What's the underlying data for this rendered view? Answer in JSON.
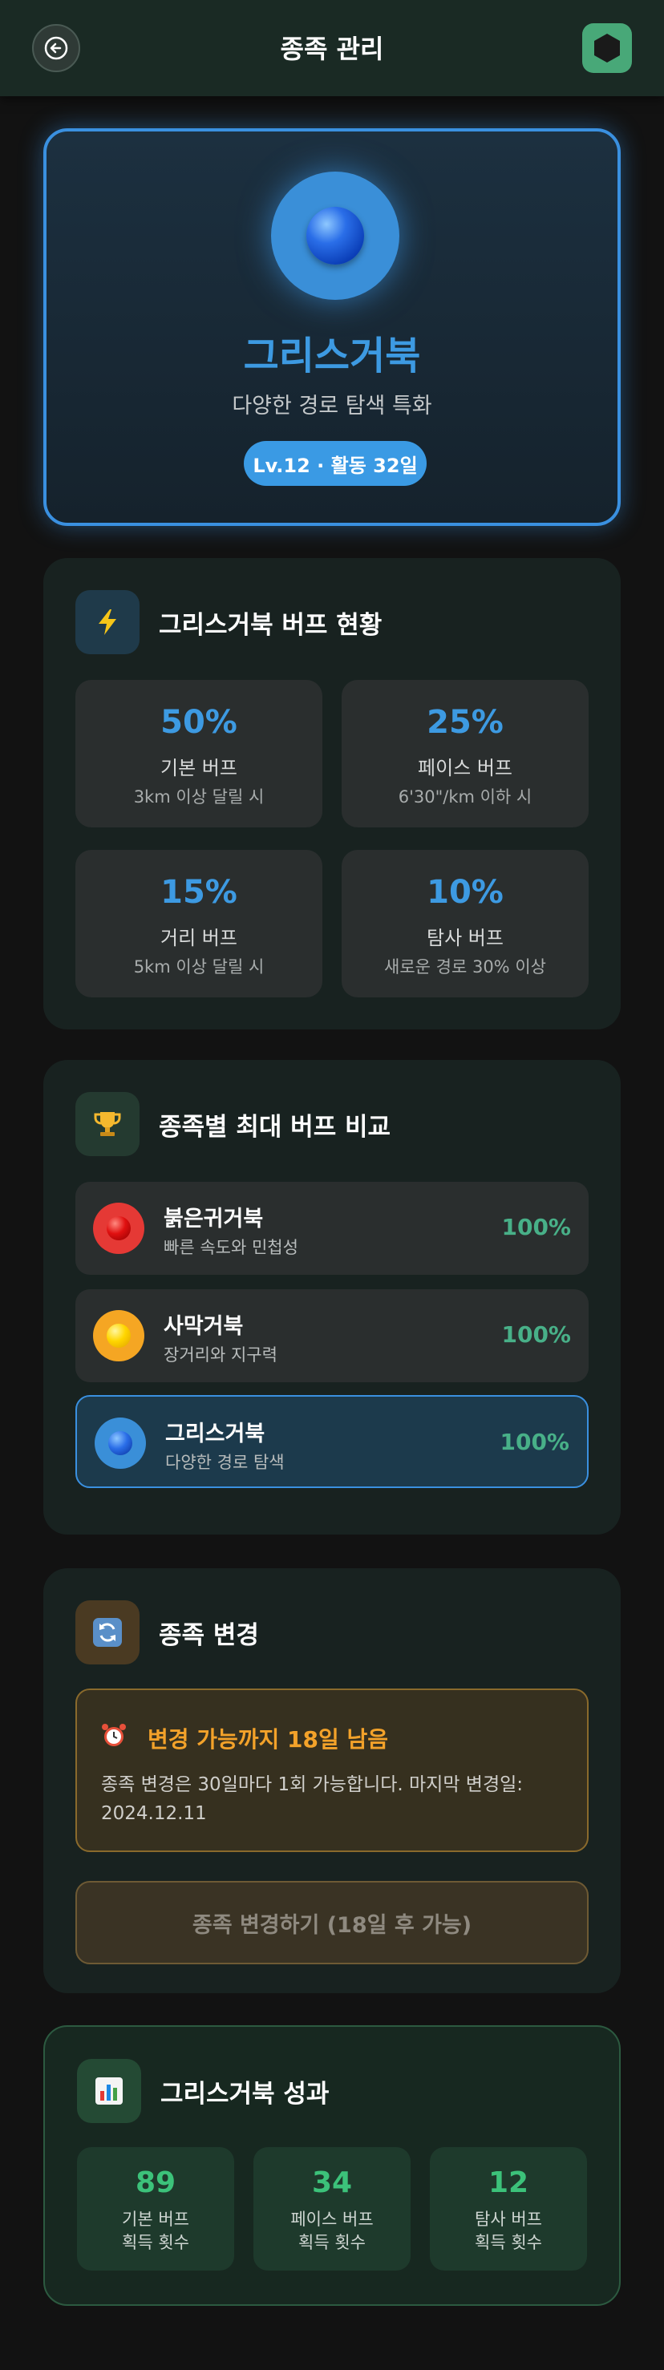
{
  "header": {
    "title": "종족 관리",
    "back_icon": "arrow-left-icon",
    "menu_icon": "hexagon-icon"
  },
  "profile": {
    "name": "그리스거북",
    "description": "다양한 경로 탐색 특화",
    "level_badge": "Lv.12 · 활동 32일",
    "accent_color": "#3d9ae2"
  },
  "buffs": {
    "icon": "lightning-icon",
    "title": "그리스거북 버프 현황",
    "items": [
      {
        "percent": "50%",
        "name": "기본 버프",
        "condition": "3km 이상 달릴 시"
      },
      {
        "percent": "25%",
        "name": "페이스 버프",
        "condition": "6'30\"/km 이하 시"
      },
      {
        "percent": "15%",
        "name": "거리 버프",
        "condition": "5km 이상 달릴 시"
      },
      {
        "percent": "10%",
        "name": "탐사 버프",
        "condition": "새로운 경로 30% 이상"
      }
    ]
  },
  "compare": {
    "icon": "trophy-icon",
    "title": "종족별 최대 버프 비교",
    "rows": [
      {
        "name": "붉은귀거북",
        "description": "빠른 속도와 민첩성",
        "percent": "100%",
        "color": "#e53935"
      },
      {
        "name": "사막거북",
        "description": "장거리와 지구력",
        "percent": "100%",
        "color": "#f5a623"
      },
      {
        "name": "그리스거북",
        "description": "다양한 경로 탐색",
        "percent": "100%",
        "color": "#3a8fd8"
      }
    ]
  },
  "change": {
    "icon": "refresh-icon",
    "title": "종족 변경",
    "notice_icon": "alarm-clock-icon",
    "notice_title": "변경 가능까지 18일 남음",
    "notice_text": "종족 변경은 30일마다 1회 가능합니다. 마지막 변경일: 2024.12.11",
    "button_label": "종족 변경하기 (18일 후 가능)"
  },
  "stats": {
    "icon": "bar-chart-icon",
    "title": "그리스거북 성과",
    "items": [
      {
        "value": "89",
        "label_line1": "기본 버프",
        "label_line2": "획득 횟수"
      },
      {
        "value": "34",
        "label_line1": "페이스 버프",
        "label_line2": "획득 횟수"
      },
      {
        "value": "12",
        "label_line1": "탐사 버프",
        "label_line2": "획득 횟수"
      }
    ]
  }
}
